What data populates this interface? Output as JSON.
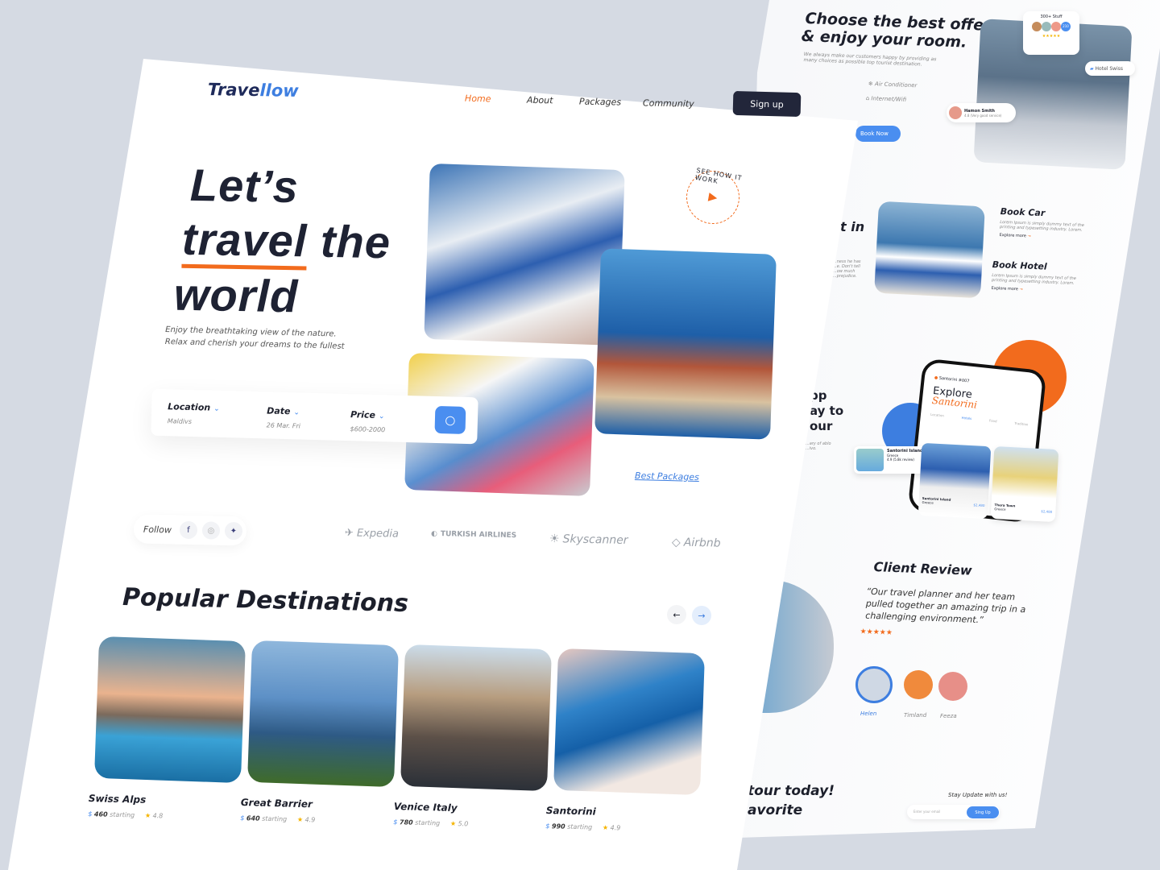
{
  "back_page": {
    "offer_title_1": "Choose the best offer",
    "offer_title_2": "& enjoy your room.",
    "offer_desc": "We always make our customers happy by providing as many choices as possible top tourist destination.",
    "amenities": [
      "Air Conditioner",
      "Internet/Wifi"
    ],
    "book_now": "Book Now",
    "staff_label": "300+ Stuff",
    "staff_count": "210",
    "staff_stars": "★★★★★",
    "hotel_badge": "Hotel Swiss",
    "reviewer": {
      "name": "Hamon Smith",
      "rating": "4.8 (Very good service)"
    },
    "partial_heading": "t in",
    "partial_text": "...ness he has ...e. Don't tell ...ow much ...prejudice.",
    "services": [
      {
        "title": "Book Car",
        "desc": "Lorem Ipsum is simply dummy text of the printing and typesetting industry. Lorem.",
        "link": "Explore more"
      },
      {
        "title": "Book Hotel",
        "desc": "Lorem Ipsum is simply dummy text of the printing and typesetting industry. Lorem.",
        "link": "Explore more"
      }
    ],
    "app_heading": [
      "pp",
      "ay to",
      "our"
    ],
    "app_text": "...ary of ablo ...ivo.",
    "phone": {
      "location": "Santorini #007",
      "title": "Explore",
      "script": "Santorini",
      "tabs": [
        "Location",
        "Hotels",
        "Food",
        "Tradition"
      ],
      "cards": [
        {
          "name": "Santorini Island",
          "place": "Greece",
          "price": "$2,480",
          "rating": "4.9 (5.8k review)"
        },
        {
          "name": "Santorini Island",
          "place": "Greece",
          "price": "$2,480"
        },
        {
          "name": "Thera Town",
          "place": "Greece",
          "price": "$2,480"
        }
      ]
    },
    "review": {
      "title": "Client Review",
      "quote": "“Our travel planner and her team pulled together an amazing trip in a challenging environment.”",
      "stars": "★★★★★",
      "people": [
        "Helen",
        "Timland",
        "Feeza"
      ]
    },
    "cta": [
      "tour today!",
      "avorite"
    ],
    "newsletter": {
      "label": "Stay Update with us!",
      "placeholder": "Enter your email",
      "button": "Sing Up"
    }
  },
  "header": {
    "logo_a": "Trave",
    "logo_b": "llow",
    "nav": [
      "Home",
      "About",
      "Packages",
      "Community"
    ],
    "signup": "Sign up"
  },
  "hero": {
    "line1": "Let’s",
    "line2a": "travel",
    "line2b": " the",
    "line3": "world",
    "desc": "Enjoy the breathtaking view of the nature. Relax and cherish your dreams to the fullest",
    "see_how": "SEE HOW IT WORK",
    "best_packages": "Best Packages"
  },
  "search": {
    "fields": [
      {
        "label": "Location",
        "value": "Maldivs"
      },
      {
        "label": "Date",
        "value": "26 Mar. Fri"
      },
      {
        "label": "Price",
        "value": "$600-2000"
      }
    ]
  },
  "follow": {
    "label": "Follow",
    "icons": [
      "facebook-icon",
      "instagram-icon",
      "twitter-icon"
    ]
  },
  "partners": [
    "Expedia",
    "TURKISH AIRLINES",
    "Skyscanner",
    "Airbnb"
  ],
  "popular": {
    "title": "Popular Destinations",
    "items": [
      {
        "name": "Swiss Alps",
        "price": "460",
        "starting": "starting",
        "rating": "4.8"
      },
      {
        "name": "Great Barrier",
        "price": "640",
        "starting": "starting",
        "rating": "4.9"
      },
      {
        "name": "Venice Italy",
        "price": "780",
        "starting": "starting",
        "rating": "5.0"
      },
      {
        "name": "Santorini",
        "price": "990",
        "starting": "starting",
        "rating": "4.9"
      }
    ]
  },
  "colors": {
    "accent": "#f26b1d",
    "blue": "#4a8ef0",
    "dark": "#22263a"
  }
}
